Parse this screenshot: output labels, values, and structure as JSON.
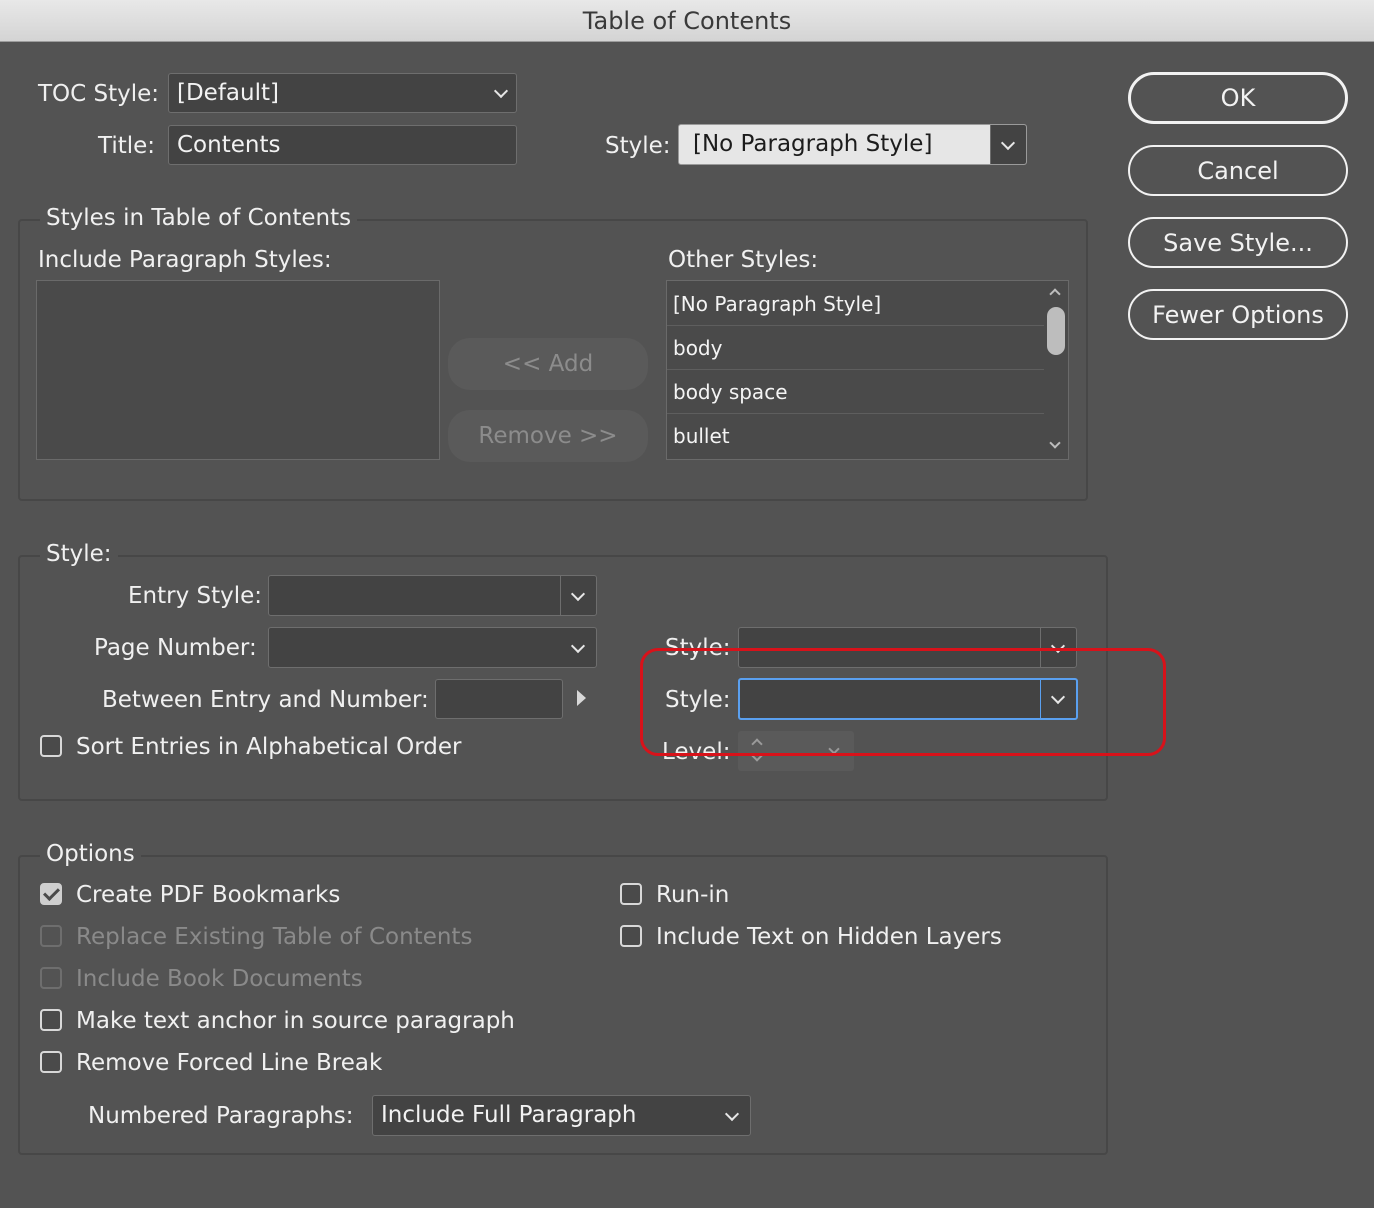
{
  "window": {
    "title": "Table of Contents"
  },
  "top": {
    "toc_style_label": "TOC Style:",
    "toc_style_value": "[Default]",
    "title_label": "Title:",
    "title_value": "Contents",
    "style_label": "Style:",
    "style_value": "[No Paragraph Style]"
  },
  "buttons": {
    "ok": "OK",
    "cancel": "Cancel",
    "save_style": "Save Style...",
    "fewer_options": "Fewer Options"
  },
  "styles_group": {
    "legend": "Styles in Table of Contents",
    "include_label": "Include Paragraph Styles:",
    "other_label": "Other Styles:",
    "add_button": "<< Add",
    "remove_button": "Remove >>",
    "other_styles": [
      "[No Paragraph Style]",
      "body",
      "body space",
      "bullet"
    ]
  },
  "style_group": {
    "legend": "Style:",
    "entry_style_label": "Entry Style:",
    "entry_style_value": "",
    "page_number_label": "Page Number:",
    "page_number_value": "",
    "page_number_style_label": "Style:",
    "page_number_style_value": "",
    "between_label": "Between Entry and Number:",
    "between_value": "",
    "between_style_label": "Style:",
    "between_style_value": "",
    "sort_label": "Sort Entries in Alphabetical Order",
    "level_label": "Level:"
  },
  "options_group": {
    "legend": "Options",
    "create_pdf_bookmarks": "Create PDF Bookmarks",
    "replace_existing": "Replace Existing Table of Contents",
    "include_book_documents": "Include Book Documents",
    "make_text_anchor": "Make text anchor in source paragraph",
    "remove_forced_line_break": "Remove Forced Line Break",
    "run_in": "Run-in",
    "include_hidden_layers": "Include Text on Hidden Layers",
    "numbered_paragraphs_label": "Numbered Paragraphs:",
    "numbered_paragraphs_value": "Include Full Paragraph"
  },
  "colors": {
    "background": "#535353",
    "highlight": "#d8121a",
    "focus": "#5aa0f0"
  }
}
